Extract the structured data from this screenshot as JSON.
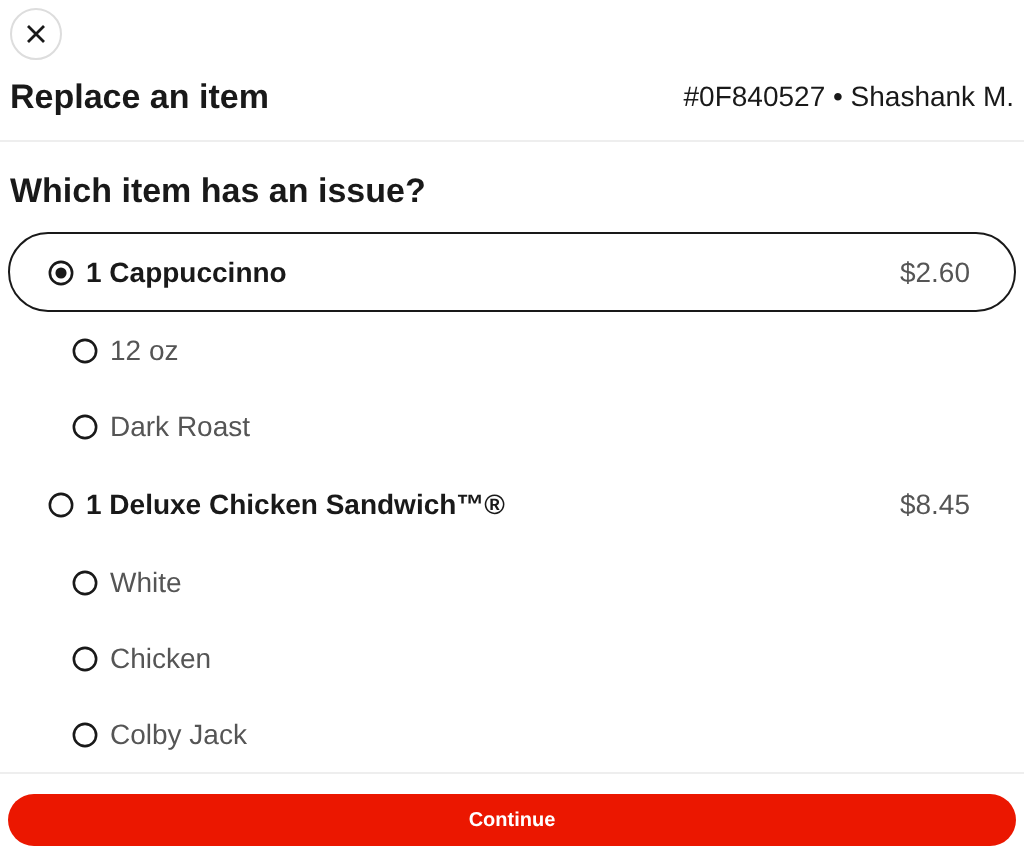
{
  "header": {
    "title": "Replace an item",
    "order_info": "#0F840527 • Shashank M."
  },
  "question": "Which item has an issue?",
  "items": [
    {
      "label": "1 Cappuccinno",
      "price": "$2.60",
      "selected": true,
      "options": [
        {
          "label": "12 oz",
          "selected": false
        },
        {
          "label": "Dark Roast",
          "selected": false
        }
      ]
    },
    {
      "label": "1 Deluxe Chicken Sandwich™®",
      "price": "$8.45",
      "selected": false,
      "options": [
        {
          "label": "White",
          "selected": false
        },
        {
          "label": "Chicken",
          "selected": false
        },
        {
          "label": "Colby Jack",
          "selected": false
        }
      ]
    }
  ],
  "continue_button": "Continue"
}
